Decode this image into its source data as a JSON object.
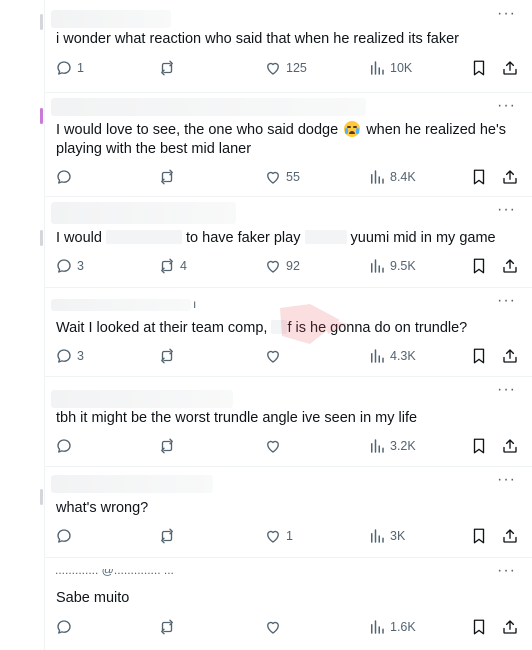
{
  "more_label": "···",
  "tweets": [
    {
      "text": "i wonder what reaction who said that when he realized its faker",
      "reply_count": "1",
      "retweet_count": "",
      "like_count": "125",
      "view_count": "10K"
    },
    {
      "text_line1_a": "I would love to see, the one who said dodge ",
      "text_line1_b": " when he realized he's",
      "text_line2": "playing with the best mid laner",
      "emoji": "loudly-crying-face",
      "reply_count": "",
      "retweet_count": "",
      "like_count": "55",
      "view_count": "8.4K"
    },
    {
      "text_a": "I would",
      "text_b": "to have faker play",
      "text_c": "yuumi mid in my game",
      "reply_count": "3",
      "retweet_count": "4",
      "like_count": "92",
      "view_count": "9.5K"
    },
    {
      "header_fragment": "ı",
      "text_a": "Wait I looked at their team comp,",
      "text_b": "f is he gonna do on trundle?",
      "reply_count": "3",
      "retweet_count": "",
      "like_count": "",
      "view_count": "4.3K"
    },
    {
      "text": "tbh it might be the worst trundle angle ive seen in my life",
      "reply_count": "",
      "retweet_count": "",
      "like_count": "",
      "view_count": "3.2K"
    },
    {
      "text": "what's wrong?",
      "reply_count": "",
      "retweet_count": "",
      "like_count": "1",
      "view_count": "3K"
    },
    {
      "header_fragment": "............. @..............  ...",
      "text": "Sabe muito",
      "reply_count": "",
      "retweet_count": "",
      "like_count": "",
      "view_count": "1.6K"
    }
  ],
  "colors": {
    "icon": "#536471",
    "text": "#0f1419",
    "divider": "#eff3f4"
  }
}
